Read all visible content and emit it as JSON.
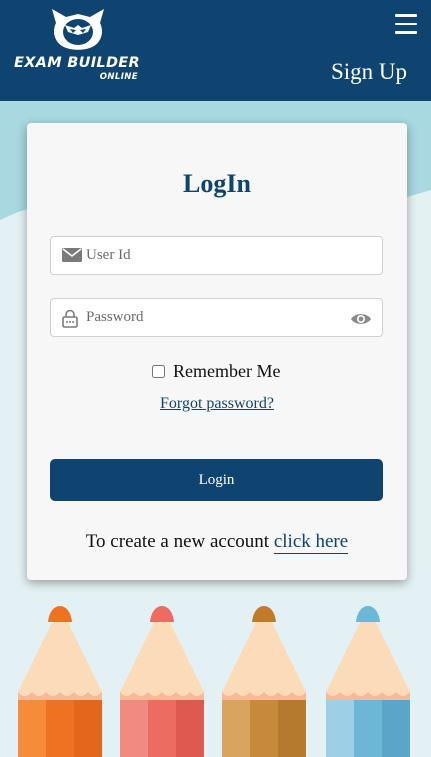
{
  "header": {
    "brand_line1": "EXAM BUILDER",
    "brand_line2": "ONLINE",
    "signup_label": "Sign Up",
    "menu_icon": "hamburger-menu-icon",
    "bg_color": "#0f4470"
  },
  "login": {
    "title": "LogIn",
    "user_placeholder": "User Id",
    "password_placeholder": "Password",
    "remember_label": "Remember Me",
    "forgot_label": "Forgot password?",
    "button_label": "Login",
    "create_prefix": "To create a new account",
    "create_link": "click here"
  },
  "decor": {
    "pencil_colors": [
      "#ef7f27",
      "#ec6c62",
      "#c78a3a",
      "#6cb6d6"
    ]
  }
}
